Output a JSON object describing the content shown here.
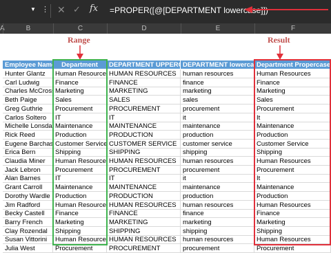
{
  "formula_bar": {
    "name_box_dropdown": "▼",
    "menu_dots": "⋮",
    "cancel_icon": "✕",
    "enter_icon": "✓",
    "fx_label": "fx",
    "formula": "=PROPER([@[DEPARTMENT lowercase]])"
  },
  "columns": [
    "A",
    "B",
    "C",
    "D",
    "E",
    "F"
  ],
  "annotations": {
    "range_label": "Range",
    "result_label": "Result"
  },
  "table": {
    "headers": [
      "Employee Name",
      "Department",
      "DEPARTMENT UPPERCASE",
      "DEPARTMENT lowercase",
      "Department Propercase"
    ],
    "rows": [
      [
        "Hunter Glantz",
        "Human Resources",
        "HUMAN RESOURCES",
        "human resources",
        "Human Resources"
      ],
      [
        "Carl Ludwig",
        "Finance",
        "FINANCE",
        "finance",
        "Finance"
      ],
      [
        "Charles McCrossin",
        "Marketing",
        "MARKETING",
        "marketing",
        "Marketing"
      ],
      [
        "Beth Paige",
        "Sales",
        "SALES",
        "sales",
        "Sales"
      ],
      [
        "Greg Guthrie",
        "Procurement",
        "PROCUREMENT",
        "procurement",
        "Procurement"
      ],
      [
        "Carlos Soltero",
        "IT",
        "IT",
        "it",
        "It"
      ],
      [
        "Michelle Lonsdale",
        "Maintenance",
        "MAINTENANCE",
        "maintenance",
        "Maintenance"
      ],
      [
        "Rick Reed",
        "Production",
        "PRODUCTION",
        "production",
        "Production"
      ],
      [
        "Eugene Barchas",
        "Customer Service",
        "CUSTOMER SERVICE",
        "customer service",
        "Customer Service"
      ],
      [
        "Erica Bern",
        "Shipping",
        "SHIPPING",
        "shipping",
        "Shipping"
      ],
      [
        "Claudia Miner",
        "Human Resources",
        "HUMAN RESOURCES",
        "human resources",
        "Human Resources"
      ],
      [
        "Jack Lebron",
        "Procurement",
        "PROCUREMENT",
        "procurement",
        "Procurement"
      ],
      [
        "Alan Barnes",
        "IT",
        "IT",
        "it",
        "It"
      ],
      [
        "Grant Carroll",
        "Maintenance",
        "MAINTENANCE",
        "maintenance",
        "Maintenance"
      ],
      [
        "Dorothy Wardle",
        "Production",
        "PRODUCTION",
        "production",
        "Production"
      ],
      [
        "Jim Radford",
        "Human Resources",
        "HUMAN RESOURCES",
        "human resources",
        "Human Resources"
      ],
      [
        "Becky Castell",
        "Finance",
        "FINANCE",
        "finance",
        "Finance"
      ],
      [
        "Barry French",
        "Marketing",
        "MARKETING",
        "marketing",
        "Marketing"
      ],
      [
        "Clay Rozendal",
        "Shipping",
        "SHIPPING",
        "shipping",
        "Shipping"
      ],
      [
        "Susan Vittorini",
        "Human Resources",
        "HUMAN RESOURCES",
        "human resources",
        "Human Resources"
      ],
      [
        "Julia West",
        "Procurement",
        "PROCUREMENT",
        "procurement",
        "Procurement"
      ]
    ]
  },
  "colors": {
    "header_blue": "#5b9bd5",
    "range_green": "#3fb34f",
    "result_red": "#e0303a",
    "label_red": "#c0504d"
  }
}
